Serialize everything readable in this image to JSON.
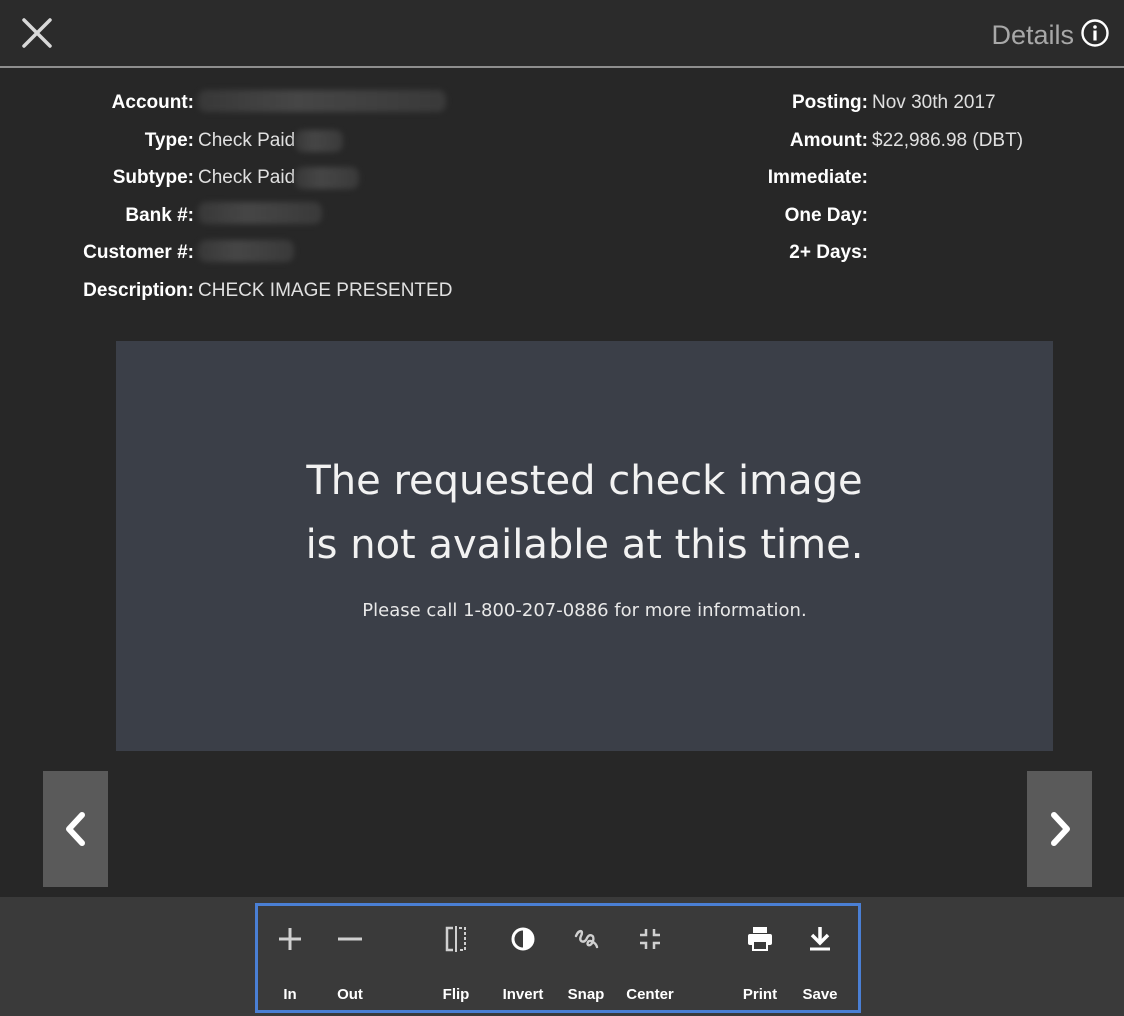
{
  "header": {
    "details_label": "Details",
    "close_icon": "close-icon",
    "info_icon": "info-icon"
  },
  "meta_left": [
    {
      "label": "Account:",
      "value": ""
    },
    {
      "label": "Type:",
      "value": "Check Paid"
    },
    {
      "label": "Subtype:",
      "value": "Check Paid"
    },
    {
      "label": "Bank #:",
      "value": ""
    },
    {
      "label": "Customer #:",
      "value": ""
    },
    {
      "label": "Description:",
      "value": "CHECK IMAGE PRESENTED"
    }
  ],
  "meta_right": [
    {
      "label": "Posting:",
      "value": "Nov 30th 2017"
    },
    {
      "label": "Amount:",
      "value": "$22,986.98 (DBT)"
    },
    {
      "label": "Immediate:",
      "value": ""
    },
    {
      "label": "One Day:",
      "value": ""
    },
    {
      "label": "2+ Days:",
      "value": ""
    }
  ],
  "image": {
    "message": "The requested check image\nis not available at this time.",
    "sub_message": "Please call 1-800-207-0886 for more information."
  },
  "nav": {
    "prev_icon": "chevron-left-icon",
    "next_icon": "chevron-right-icon"
  },
  "toolbar": {
    "zoom_in": "In",
    "zoom_out": "Out",
    "flip": "Flip",
    "invert": "Invert",
    "snap": "Snap",
    "center": "Center",
    "print": "Print",
    "save": "Save"
  },
  "colors": {
    "background": "#272727",
    "image_area": "#3b3f48",
    "toolbar_border": "#4a7fd4"
  }
}
